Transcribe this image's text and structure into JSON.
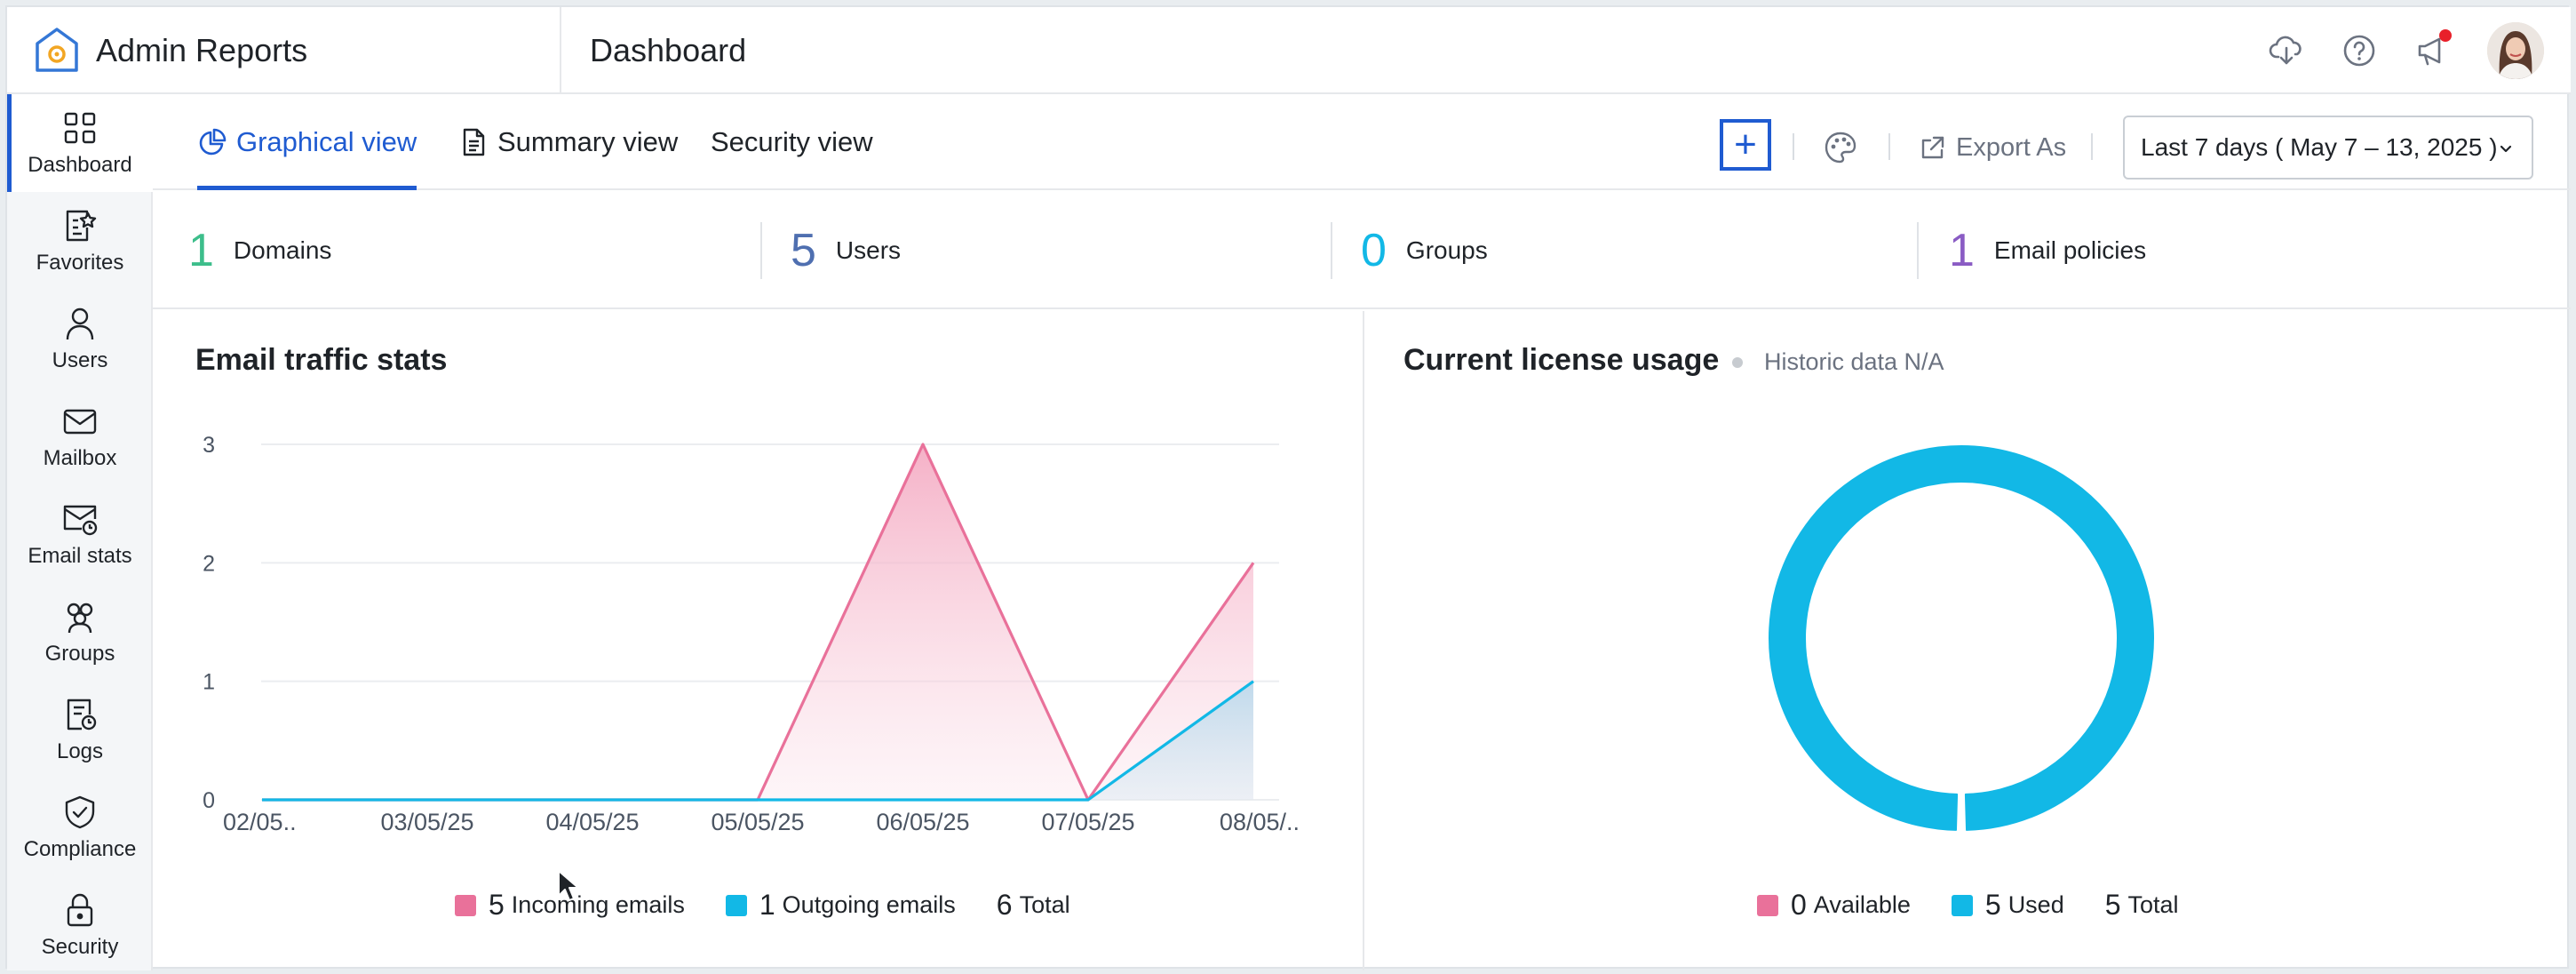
{
  "app": {
    "title": "Admin Reports",
    "page_title": "Dashboard"
  },
  "header_icons": [
    "cloud-download-icon",
    "help-icon",
    "announcement-icon"
  ],
  "sidebar": {
    "items": [
      {
        "label": "Dashboard",
        "icon": "grid-icon",
        "active": true
      },
      {
        "label": "Favorites",
        "icon": "favorites-icon"
      },
      {
        "label": "Users",
        "icon": "user-icon"
      },
      {
        "label": "Mailbox",
        "icon": "mail-icon"
      },
      {
        "label": "Email stats",
        "icon": "email-stats-icon"
      },
      {
        "label": "Groups",
        "icon": "groups-icon"
      },
      {
        "label": "Logs",
        "icon": "logs-icon"
      },
      {
        "label": "Compliance",
        "icon": "shield-check-icon"
      },
      {
        "label": "Security",
        "icon": "lock-icon"
      }
    ]
  },
  "tabs": [
    {
      "label": "Graphical view",
      "icon": "pie-chart-icon",
      "active": true
    },
    {
      "label": "Summary view",
      "icon": "document-icon"
    },
    {
      "label": "Security view"
    }
  ],
  "toolbar": {
    "add_label": "+",
    "export_label": "Export As",
    "date_range": "Last 7 days ( May 7 – 13, 2025 )"
  },
  "stats": [
    {
      "value": "1",
      "label": "Domains",
      "color": "#3dbe8b"
    },
    {
      "value": "5",
      "label": "Users",
      "color": "#4f6fb0"
    },
    {
      "value": "0",
      "label": "Groups",
      "color": "#12b8e6"
    },
    {
      "value": "1",
      "label": "Email policies",
      "color": "#8a5cc4"
    }
  ],
  "email_traffic": {
    "title": "Email traffic stats",
    "legend": {
      "incoming": {
        "value": "5",
        "label": "Incoming emails"
      },
      "outgoing": {
        "value": "1",
        "label": "Outgoing emails"
      },
      "total": {
        "value": "6",
        "label": "Total"
      }
    }
  },
  "license": {
    "title": "Current license usage",
    "note": "Historic data N/A",
    "legend": {
      "available": {
        "value": "0",
        "label": "Available"
      },
      "used": {
        "value": "5",
        "label": "Used"
      },
      "total": {
        "value": "5",
        "label": "Total"
      }
    }
  },
  "colors": {
    "accent": "#1f5bd1",
    "incoming": "#e9719a",
    "outgoing": "#12b8e6"
  },
  "chart_data": [
    {
      "type": "area",
      "title": "Email traffic stats",
      "categories": [
        "02/05..",
        "03/05/25",
        "04/05/25",
        "05/05/25",
        "06/05/25",
        "07/05/25",
        "08/05/.."
      ],
      "series": [
        {
          "name": "Incoming emails",
          "values": [
            0,
            0,
            0,
            0,
            3,
            0,
            2
          ]
        },
        {
          "name": "Outgoing emails",
          "values": [
            0,
            0,
            0,
            0,
            0,
            0,
            1
          ]
        }
      ],
      "yticks": [
        "0",
        "1",
        "2",
        "3"
      ],
      "ylim": [
        0,
        3
      ],
      "grid": true
    },
    {
      "type": "pie",
      "title": "Current license usage",
      "categories": [
        "Available",
        "Used"
      ],
      "values": [
        0,
        5
      ]
    }
  ]
}
